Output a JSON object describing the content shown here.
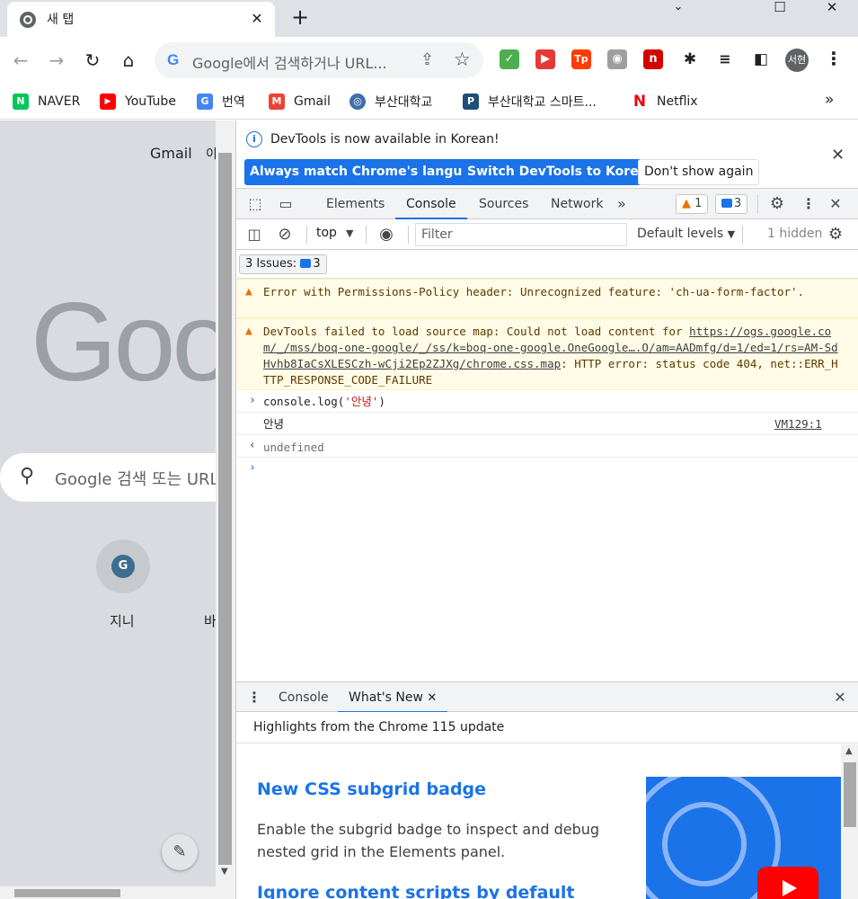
{
  "browser": {
    "tab_title": "새 탭",
    "tab_close": "✕",
    "new_tab": "+",
    "window_controls": {
      "minimize": "─",
      "maximize": "☐",
      "close": "✕"
    },
    "nav": {
      "back": "←",
      "forward": "→",
      "reload": "↻",
      "home": "⌂"
    },
    "omnibox": {
      "g_letter": "G",
      "placeholder": "Google에서 검색하거나 URL..."
    },
    "profile_initials": "서현",
    "extensions": [
      {
        "name": "extension-icon-1",
        "glyph": "✓",
        "color": "#4caf50"
      },
      {
        "name": "extension-icon-2",
        "glyph": "▶",
        "color": "#e53935"
      },
      {
        "name": "extension-icon-3",
        "glyph": "Tp",
        "color": "#ff3d00"
      },
      {
        "name": "extension-icon-4",
        "glyph": "◉",
        "color": "#9e9e9e"
      },
      {
        "name": "extension-icon-5",
        "glyph": "n",
        "color": "#d50000"
      }
    ]
  },
  "bookmarks": [
    {
      "label": "NAVER",
      "glyph": "N",
      "color": "#03c75a"
    },
    {
      "label": "YouTube",
      "glyph": "▶",
      "color": "#ff0000"
    },
    {
      "label": "번역",
      "glyph": "G",
      "color": "#4285f4"
    },
    {
      "label": "Gmail",
      "glyph": "M",
      "color": "#ea4335"
    },
    {
      "label": "부산대학교",
      "glyph": "◎",
      "color": "#3f6fa8"
    },
    {
      "label": "부산대학교 스마트...",
      "glyph": "P",
      "color": "#1f4e79"
    },
    {
      "label": "Netflix",
      "glyph": "N",
      "color": "#e50914"
    }
  ],
  "bookmarks_more": "»",
  "ntp": {
    "gmail": "Gmail",
    "images_partial": "이",
    "logo": "Goo",
    "search_placeholder": "Google 검색 또는 URL",
    "shortcut_1": {
      "glyph": "G",
      "label": "지니"
    },
    "shortcut_2_partial": "바",
    "edit_icon": "✎"
  },
  "devtools": {
    "infobar": {
      "message": "DevTools is now available in Korean!",
      "btn_match": "Always match Chrome's language",
      "btn_switch": "Switch DevTools to Korean",
      "btn_dismiss": "Don't show again",
      "close": "✕"
    },
    "tabs": [
      "Elements",
      "Console",
      "Sources",
      "Network"
    ],
    "active_tab": "Console",
    "more_tabs": "»",
    "warning_count": "1",
    "info_count": "3",
    "console_toolbar": {
      "context": "top",
      "filter_placeholder": "Filter",
      "levels": "Default levels",
      "hidden": "1 hidden"
    },
    "issues": {
      "label": "3 Issues:",
      "count": "3"
    },
    "messages": {
      "warn1": "Error with Permissions-Policy header: Unrecognized feature: 'ch-ua-form-factor'.",
      "warn2_prefix": "DevTools failed to load source map: Could not load content for ",
      "warn2_url": "https://ogs.google.com/_/mss/boq-one-google/_/ss/k=boq-one-google.OneGoogle….O/am=AADmfg/d=1/ed=1/rs=AM-SdHvhb8IaCsXLESCzh-wCji2Ep2ZJXg/chrome.css.map",
      "warn2_suffix": ": HTTP error: status code 404, net::ERR_HTTP_RESPONSE_CODE_FAILURE",
      "input_fn": "console.log(",
      "input_arg": "'안녕'",
      "input_close": ")",
      "output": "안녕",
      "output_source": "VM129:1",
      "return_value": "undefined"
    },
    "drawer": {
      "tabs": [
        "Console",
        "What's New"
      ],
      "active_tab": "What's New",
      "close": "✕",
      "header": "Highlights from the Chrome 115 update",
      "item1_title": "New CSS subgrid badge",
      "item1_desc": "Enable the subgrid badge to inspect and debug nested grid in the Elements panel.",
      "item2_title": "Ignore content scripts by default"
    }
  },
  "colors": {
    "accent": "#1a73e8",
    "warning_bg": "#fffbe6",
    "warning_icon": "#e37400",
    "string_literal": "#c41a16"
  }
}
